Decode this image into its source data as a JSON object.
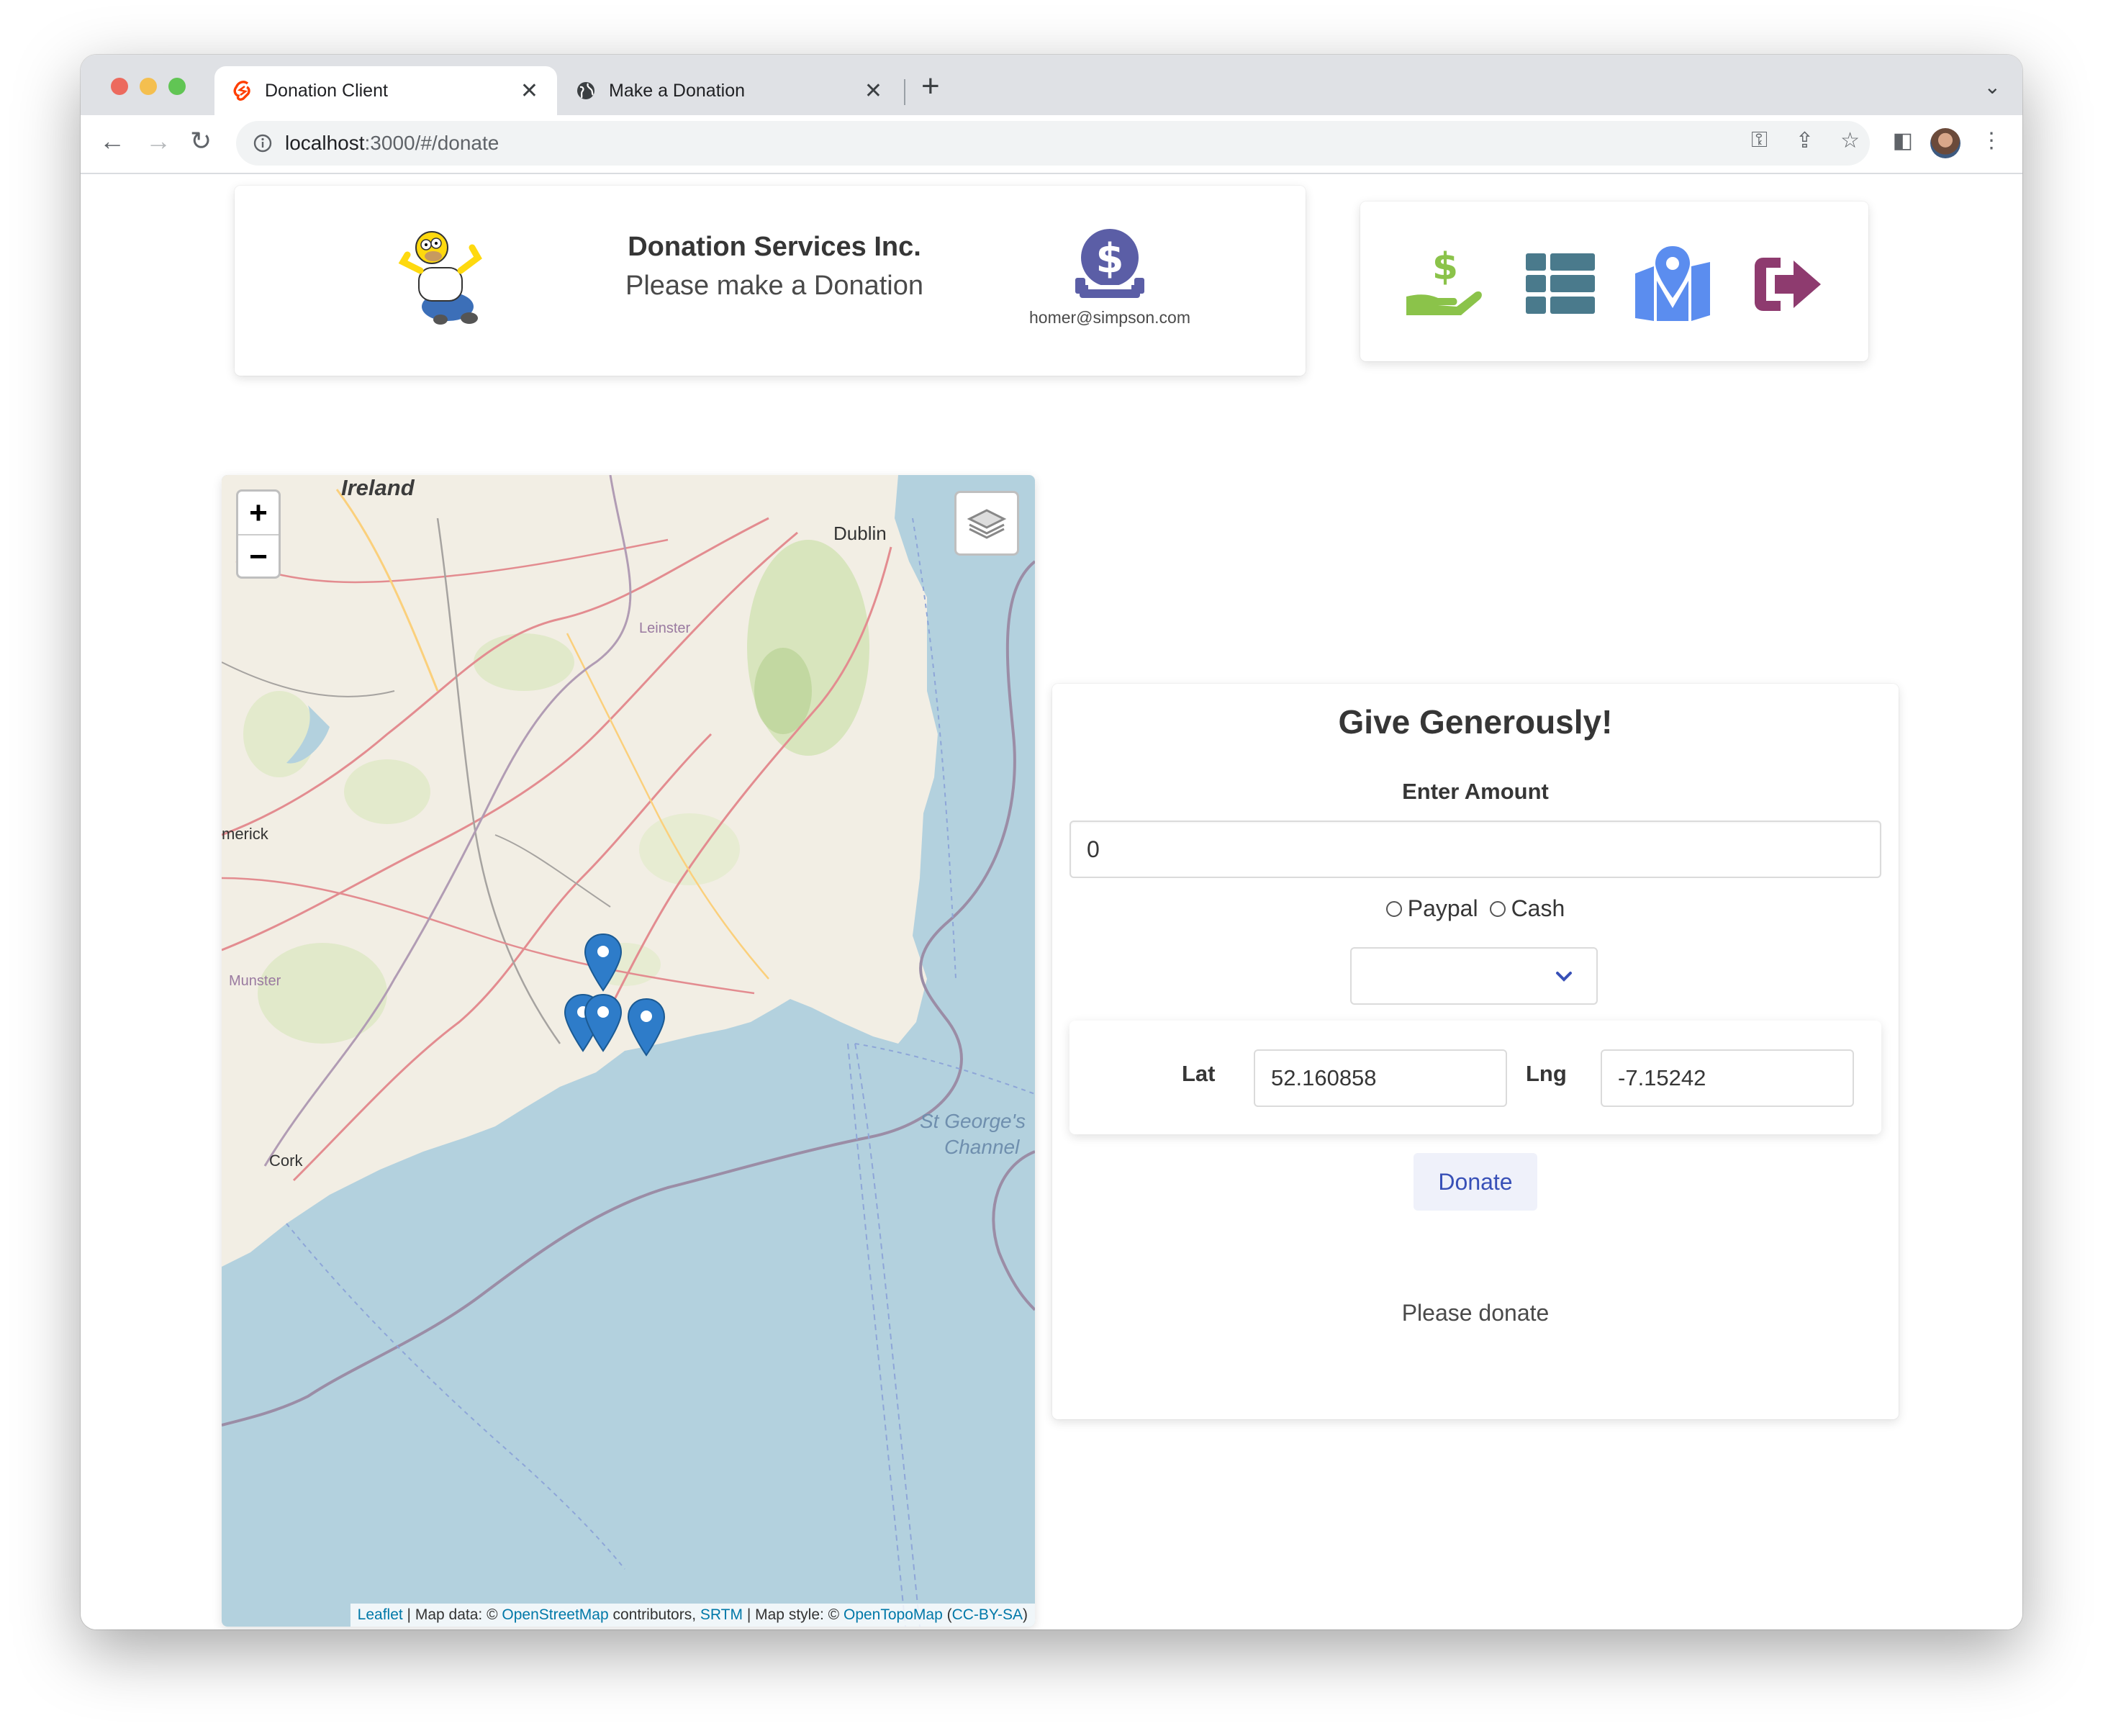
{
  "browser": {
    "tabs": [
      {
        "title": "Donation Client",
        "active": true,
        "icon": "svelte-icon"
      },
      {
        "title": "Make a Donation",
        "active": false,
        "icon": "globe-icon"
      }
    ],
    "url": {
      "host": "localhost",
      "path": ":3000/#/donate"
    }
  },
  "header": {
    "title": "Donation Services Inc.",
    "subtitle": "Please make a Donation",
    "user_email": "homer@simpson.com",
    "colors": {
      "user_icon": "#5b5ea6"
    }
  },
  "nav": {
    "items": [
      {
        "icon": "donate-hand-dollar-icon",
        "color": "#8bc34a"
      },
      {
        "icon": "report-table-icon",
        "color": "#4a7a8c"
      },
      {
        "icon": "map-marker-icon",
        "color": "#5b8def"
      },
      {
        "icon": "logout-icon",
        "color": "#8e3b6f"
      }
    ]
  },
  "map": {
    "zoom_in": "+",
    "zoom_out": "−",
    "place_labels": {
      "ireland": "Ireland",
      "dublin": "Dublin",
      "leinster": "Leinster",
      "limerick": "merick",
      "munster": "Munster",
      "cork": "Cork",
      "st_georges_1": "St George's",
      "st_georges_2": "Channel"
    },
    "attribution": {
      "leaflet": "Leaflet",
      "sep1": " | Map data: © ",
      "osm": "OpenStreetMap",
      "contrib": " contributors, ",
      "srtm": "SRTM",
      "style": " | Map style: © ",
      "opentopo": "OpenTopoMap",
      "open_paren": " (",
      "license": "CC-BY-SA",
      "close_paren": ")"
    }
  },
  "donate_form": {
    "title": "Give Generously!",
    "amount_label": "Enter Amount",
    "amount_value": "0",
    "methods": [
      "Paypal",
      "Cash"
    ],
    "selected_candidate": "",
    "lat_label": "Lat",
    "lat_value": "52.160858",
    "lng_label": "Lng",
    "lng_value": "-7.15242",
    "submit_label": "Donate",
    "status_message": "Please donate"
  }
}
